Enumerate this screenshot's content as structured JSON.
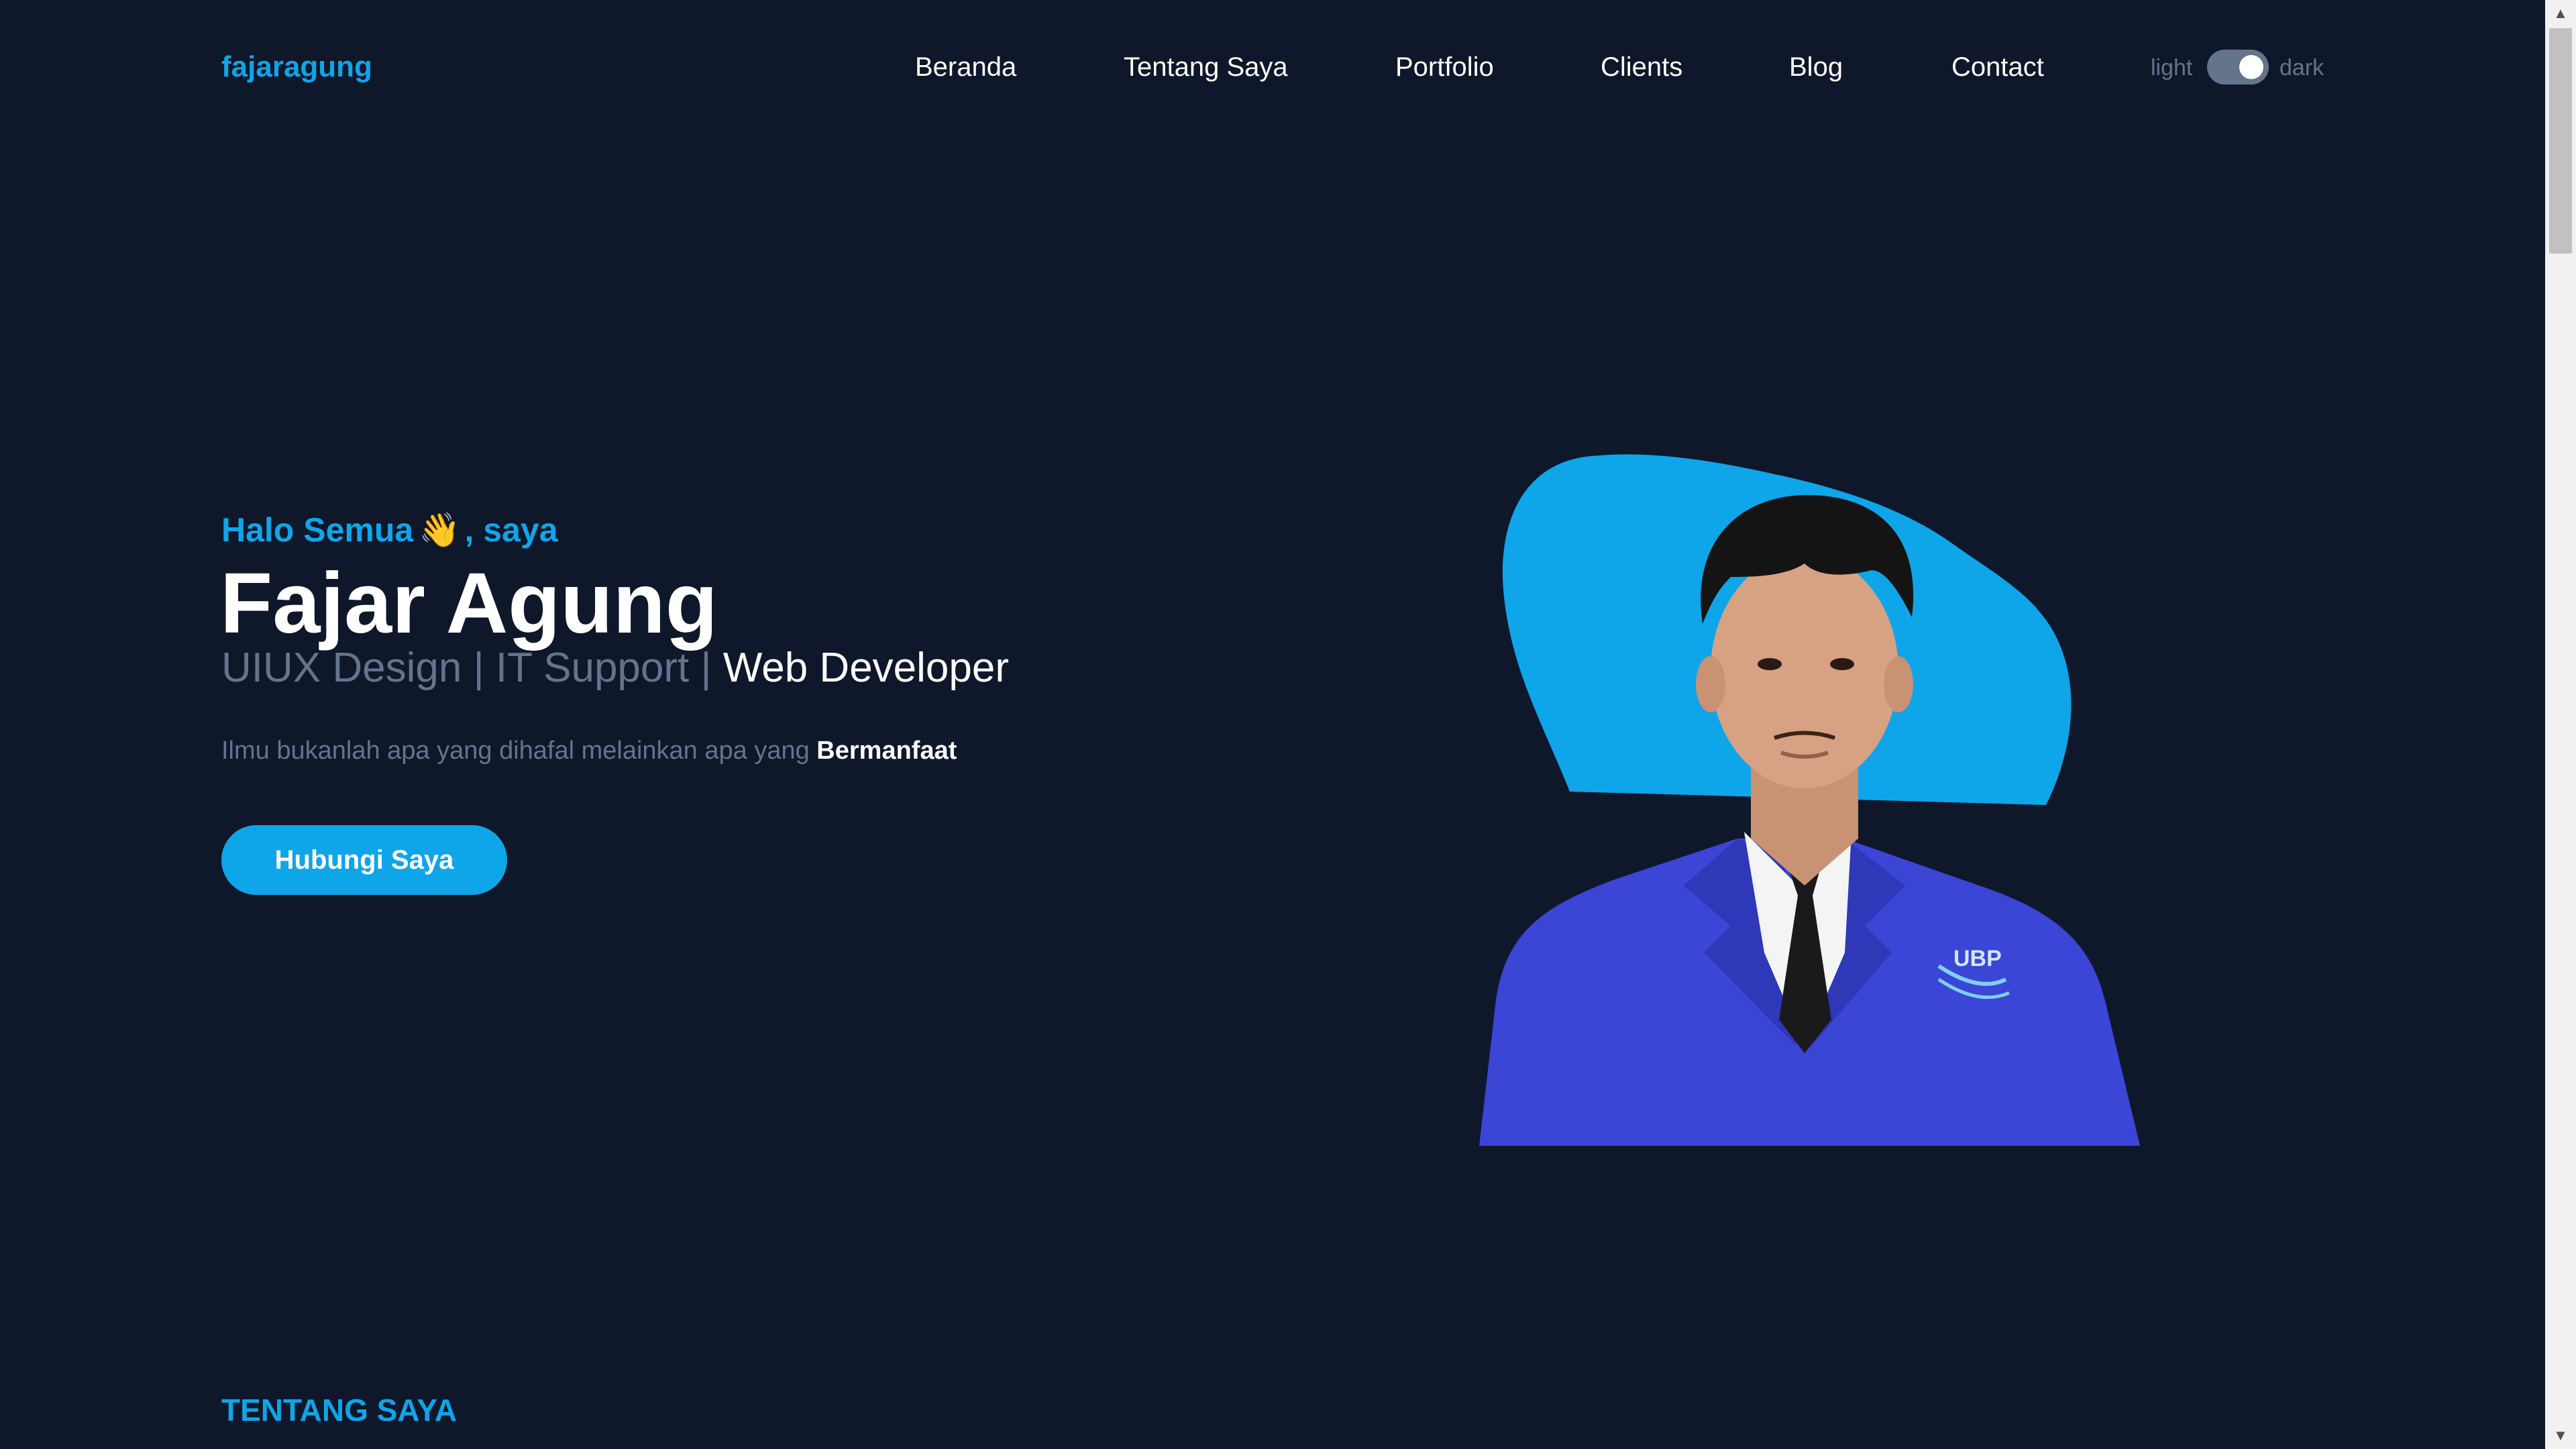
{
  "header": {
    "logo": "fajaragung",
    "nav": [
      "Beranda",
      "Tentang Saya",
      "Portfolio",
      "Clients",
      "Blog",
      "Contact"
    ],
    "theme_toggle": {
      "light_label": "light",
      "dark_label": "dark",
      "state": "dark"
    }
  },
  "hero": {
    "greeting_before": "Halo Semua",
    "greeting_emoji": "👋",
    "greeting_after": ", saya",
    "name": "Fajar Agung",
    "roles_muted": "UIUX Design | IT Support | ",
    "roles_highlight": "Web Developer",
    "tagline_text": "Ilmu bukanlah apa yang dihafal melainkan apa yang ",
    "tagline_bold": "Bermanfaat",
    "cta_label": "Hubungi Saya",
    "photo_alt": "Fajar Agung",
    "badge_text": "UBP"
  },
  "sections": {
    "about_title": "TENTANG SAYA"
  },
  "colors": {
    "background": "#0f172a",
    "accent": "#0ea5e9",
    "muted": "#64748b",
    "jacket": "#3b45d6"
  },
  "icons": [
    "wave-icon",
    "scroll-up-icon",
    "scroll-down-icon"
  ]
}
